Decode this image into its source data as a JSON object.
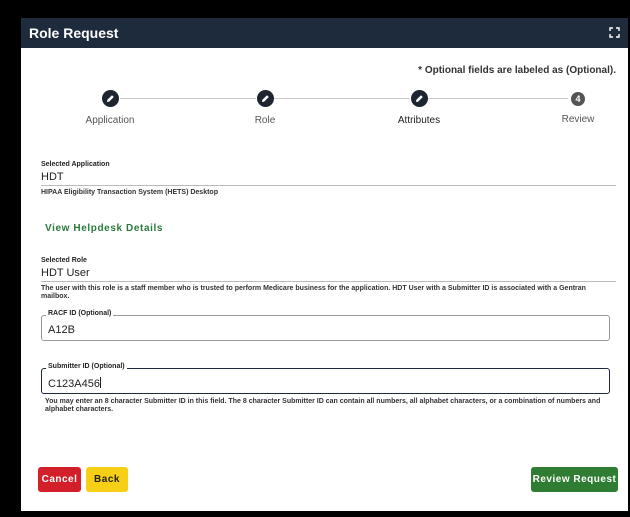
{
  "window": {
    "title": "Role Request",
    "expand_icon": "expand-icon"
  },
  "optional_note": "* Optional fields are labeled as (Optional).",
  "steps": [
    {
      "label": "Application",
      "status": "completed",
      "icon": "pencil-icon"
    },
    {
      "label": "Role",
      "status": "completed",
      "icon": "pencil-icon"
    },
    {
      "label": "Attributes",
      "status": "active",
      "icon": "pencil-icon"
    },
    {
      "label": "Review",
      "status": "pending",
      "number": "4"
    }
  ],
  "application": {
    "label": "Selected Application",
    "value": "HDT",
    "description": "HIPAA Eligibility Transaction System (HETS) Desktop"
  },
  "helpdesk_link": "View Helpdesk Details",
  "role": {
    "label": "Selected Role",
    "value": "HDT User",
    "description": "The user with this role is a staff member who is trusted to perform Medicare business for the application. HDT User with a Submitter ID is associated with a Gentran mailbox."
  },
  "racf": {
    "label": "RACF ID (Optional)",
    "value": "A12B"
  },
  "submitter": {
    "label": "Submitter ID (Optional)",
    "value": "C123A456",
    "help": "You may enter an 8 character Submitter ID in this field. The 8 character Submitter ID can contain all numbers, all alphabet characters, or a combination of numbers and alphabet characters."
  },
  "buttons": {
    "cancel": "Cancel",
    "back": "Back",
    "review": "Review Request"
  },
  "colors": {
    "header": "#1e2b3c",
    "link": "#2a7a3b",
    "cancel": "#d31f2a",
    "back": "#f7cf16",
    "review": "#2e7d32"
  }
}
